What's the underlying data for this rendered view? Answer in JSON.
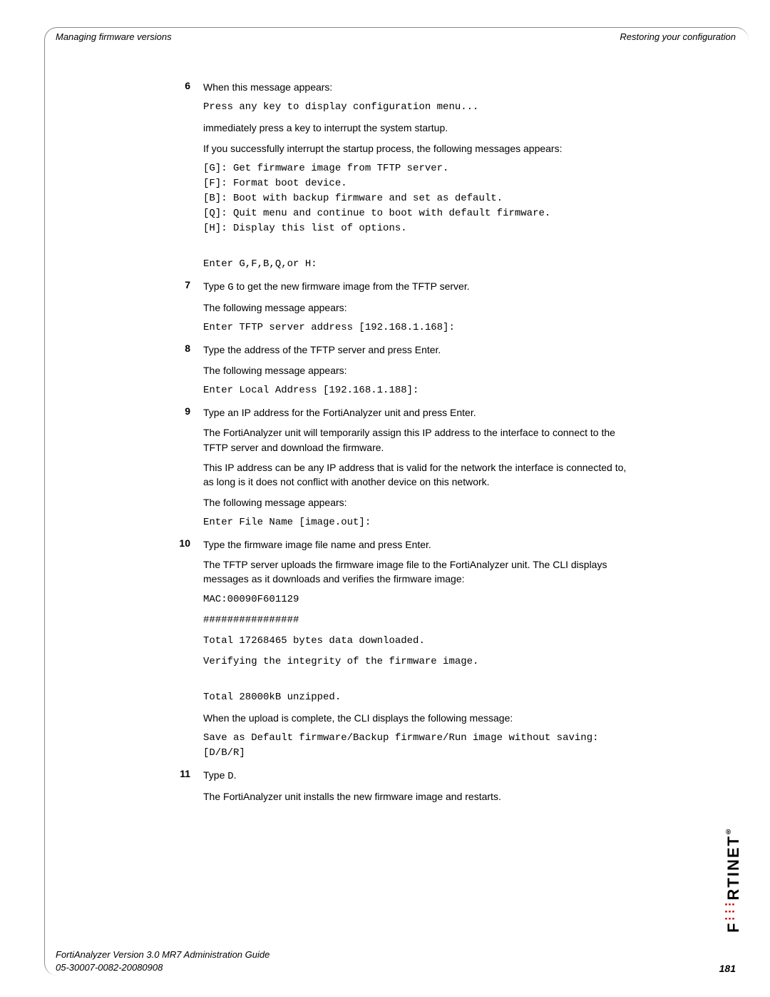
{
  "header": {
    "left": "Managing firmware versions",
    "right": "Restoring your configuration"
  },
  "steps": [
    {
      "num": "6",
      "blocks": [
        {
          "type": "para",
          "text": "When this message appears:"
        },
        {
          "type": "code",
          "text": "Press any key to display configuration menu..."
        },
        {
          "type": "para",
          "text": "immediately press a key to interrupt the system startup."
        },
        {
          "type": "para",
          "text": "If you successfully interrupt the startup process, the following messages appears:"
        },
        {
          "type": "code",
          "text": "[G]: Get firmware image from TFTP server.\n[F]: Format boot device.\n[B]: Boot with backup firmware and set as default.\n[Q]: Quit menu and continue to boot with default firmware.\n[H]: Display this list of options."
        },
        {
          "type": "code",
          "text": "\nEnter G,F,B,Q,or H:"
        }
      ]
    },
    {
      "num": "7",
      "blocks": [
        {
          "type": "para-mixed",
          "pre": "Type ",
          "code": "G",
          "post": " to get the new firmware image from the TFTP server."
        },
        {
          "type": "para",
          "text": "The following message appears:"
        },
        {
          "type": "code",
          "text": "Enter TFTP server address [192.168.1.168]:"
        }
      ]
    },
    {
      "num": "8",
      "blocks": [
        {
          "type": "para",
          "text": "Type the address of the TFTP server and press Enter."
        },
        {
          "type": "para",
          "text": "The following message appears:"
        },
        {
          "type": "code",
          "text": "Enter Local Address [192.168.1.188]:"
        }
      ]
    },
    {
      "num": "9",
      "blocks": [
        {
          "type": "para",
          "text": "Type an IP address for the FortiAnalyzer unit and press Enter."
        },
        {
          "type": "para",
          "text": "The FortiAnalyzer unit will temporarily assign this IP address to the interface to connect to the TFTP server and download the firmware."
        },
        {
          "type": "para",
          "text": "This IP address can be any IP address that is valid for the network the interface is connected to, as long is it does not conflict with another device on this network."
        },
        {
          "type": "para",
          "text": "The following message appears:"
        },
        {
          "type": "code",
          "text": "Enter File Name [image.out]:"
        }
      ]
    },
    {
      "num": "10",
      "blocks": [
        {
          "type": "para",
          "text": "Type the firmware image file name and press Enter."
        },
        {
          "type": "para",
          "text": "The TFTP server uploads the firmware image file to the FortiAnalyzer unit. The CLI displays messages as it downloads and verifies the firmware image:"
        },
        {
          "type": "code",
          "text": "MAC:00090F601129"
        },
        {
          "type": "code",
          "text": "################"
        },
        {
          "type": "code",
          "text": "Total 17268465 bytes data downloaded."
        },
        {
          "type": "code",
          "text": "Verifying the integrity of the firmware image."
        },
        {
          "type": "code",
          "text": "\nTotal 28000kB unzipped."
        },
        {
          "type": "para",
          "text": "When the upload is complete, the CLI displays the following message:"
        },
        {
          "type": "code",
          "text": "Save as Default firmware/Backup firmware/Run image without saving:[D/B/R]"
        }
      ]
    },
    {
      "num": "11",
      "blocks": [
        {
          "type": "para-mixed",
          "pre": "Type ",
          "code": "D",
          "post": "."
        },
        {
          "type": "para",
          "text": "The FortiAnalyzer unit installs the new firmware image and restarts."
        }
      ]
    }
  ],
  "footer": {
    "line1": "FortiAnalyzer Version 3.0 MR7 Administration Guide",
    "line2": "05-30007-0082-20080908",
    "page": "181"
  },
  "logo": "F   RTINET"
}
